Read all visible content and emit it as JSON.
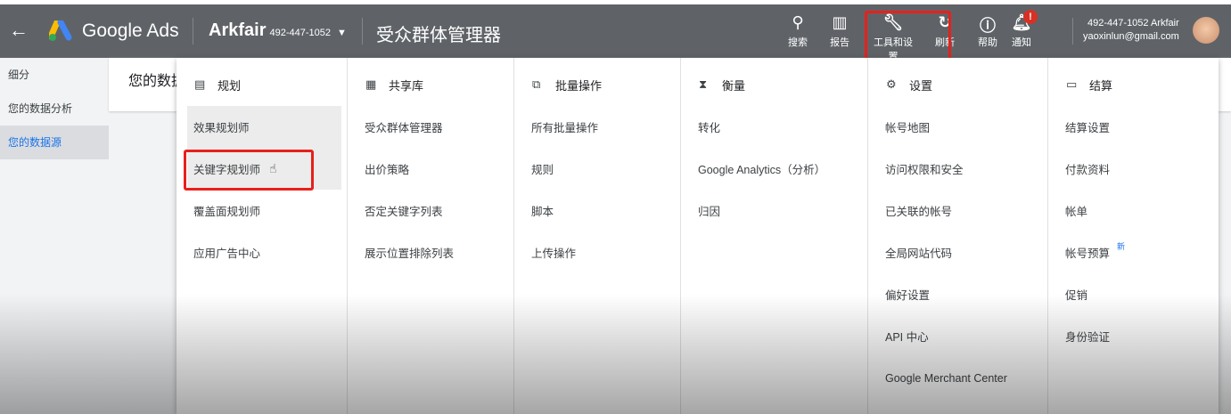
{
  "header": {
    "back_icon": "arrow-left",
    "brand": "Google Ads",
    "account_name": "Arkfair",
    "account_id": "492-447-1052",
    "page_title": "受众群体管理器",
    "actions": [
      {
        "icon": "search-icon",
        "label": "搜索"
      },
      {
        "icon": "report-icon",
        "label": "报告"
      },
      {
        "icon": "wrench-icon",
        "label": "工具和设置"
      },
      {
        "icon": "refresh-icon",
        "label": "刷新"
      },
      {
        "icon": "help-icon",
        "label": "帮助"
      },
      {
        "icon": "bell-icon",
        "label": "通知"
      }
    ],
    "notification_badge": "!",
    "user_line1": "492-447-1052 Arkfair",
    "user_email": "yaoxinlun@gmail.com"
  },
  "sidebar": {
    "items": [
      "细分",
      "您的数据分析",
      "您的数据源"
    ]
  },
  "content": {
    "subheader": "您的数据源"
  },
  "menu": {
    "columns": [
      {
        "title": "规划",
        "icon": "calendar-icon",
        "items": [
          "效果规划师",
          "关键字规划师",
          "覆盖面规划师",
          "应用广告中心"
        ]
      },
      {
        "title": "共享库",
        "icon": "library-icon",
        "items": [
          "受众群体管理器",
          "出价策略",
          "否定关键字列表",
          "展示位置排除列表"
        ]
      },
      {
        "title": "批量操作",
        "icon": "copy-icon",
        "items": [
          "所有批量操作",
          "规则",
          "脚本",
          "上传操作"
        ]
      },
      {
        "title": "衡量",
        "icon": "hourglass-icon",
        "items": [
          "转化",
          "Google Analytics（分析）",
          "归因"
        ]
      },
      {
        "title": "设置",
        "icon": "settings-icon",
        "items": [
          "帐号地图",
          "访问权限和安全",
          "已关联的帐号",
          "全局网站代码",
          "偏好设置",
          "API 中心",
          "Google Merchant Center"
        ]
      },
      {
        "title": "结算",
        "icon": "card-icon",
        "items": [
          "结算设置",
          "付款资料",
          "帐单",
          "帐号预算",
          "促销",
          "身份验证"
        ]
      }
    ],
    "new_badge": "新"
  }
}
